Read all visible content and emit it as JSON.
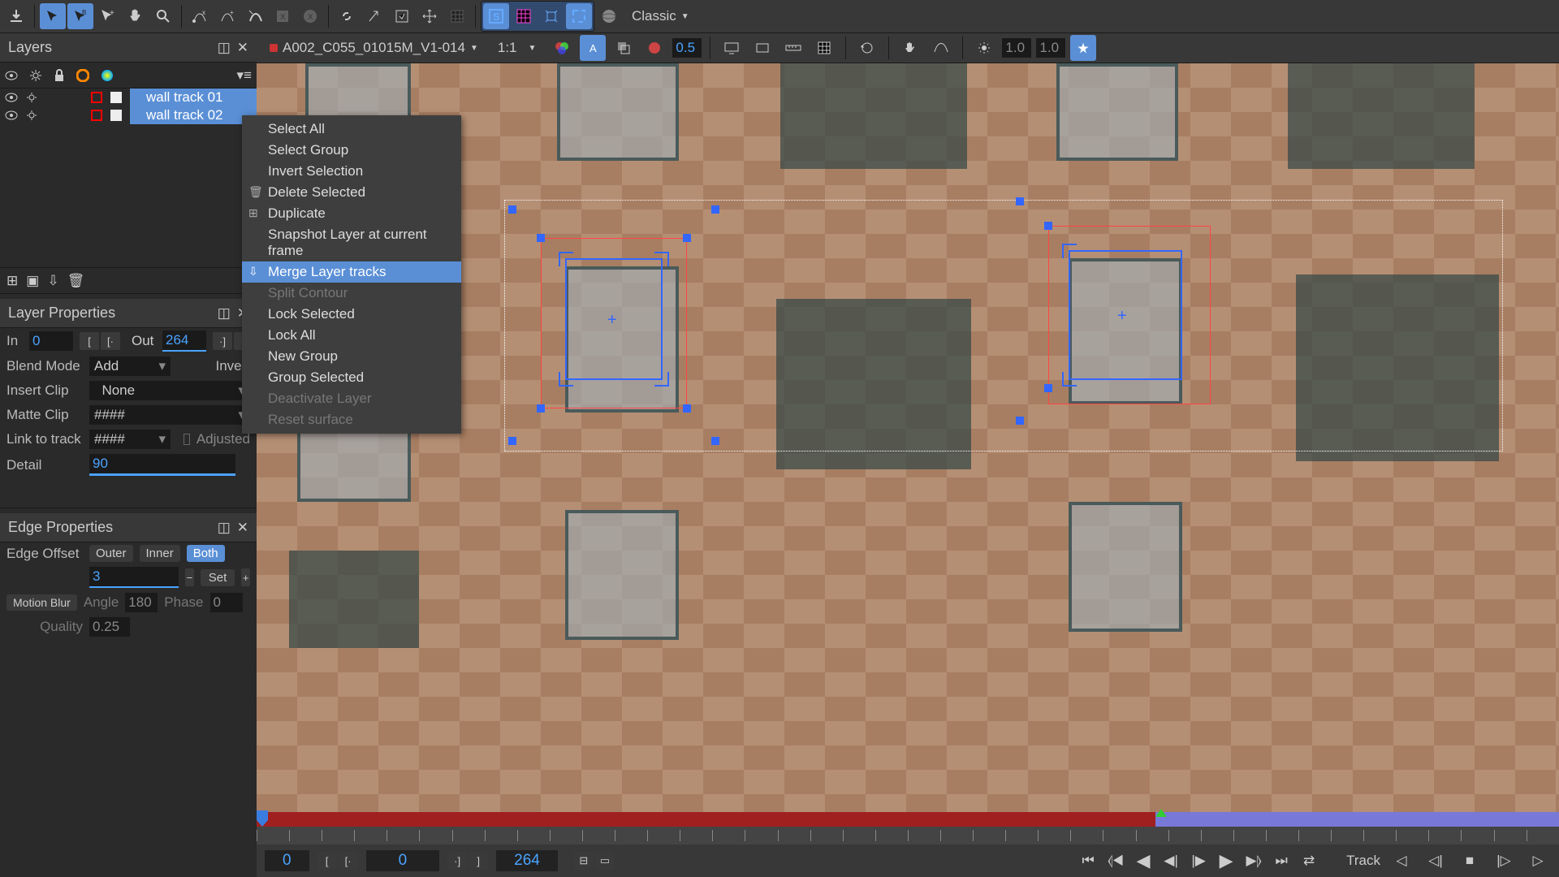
{
  "toolbar": {
    "layout_dropdown": "Classic"
  },
  "layers_panel": {
    "title": "Layers",
    "items": [
      {
        "name": "wall track 01"
      },
      {
        "name": "wall track 02"
      }
    ]
  },
  "context_menu": {
    "items": [
      {
        "label": "Select All",
        "icon": "",
        "disabled": false
      },
      {
        "label": "Select Group",
        "icon": "",
        "disabled": false
      },
      {
        "label": "Invert Selection",
        "icon": "",
        "disabled": false
      },
      {
        "label": "Delete Selected",
        "icon": "🗑",
        "disabled": false
      },
      {
        "label": "Duplicate",
        "icon": "⊞",
        "disabled": false
      },
      {
        "label": "Snapshot Layer at current frame",
        "icon": "",
        "disabled": false
      },
      {
        "label": "Merge Layer tracks",
        "icon": "⇩",
        "disabled": false,
        "highlight": true
      },
      {
        "label": "Split Contour",
        "icon": "",
        "disabled": true
      },
      {
        "label": "Lock Selected",
        "icon": "",
        "disabled": false
      },
      {
        "label": "Lock All",
        "icon": "",
        "disabled": false
      },
      {
        "label": "New Group",
        "icon": "",
        "disabled": false
      },
      {
        "label": "Group Selected",
        "icon": "",
        "disabled": false
      },
      {
        "label": "Deactivate Layer",
        "icon": "",
        "disabled": true
      },
      {
        "label": "Reset surface",
        "icon": "",
        "disabled": true
      }
    ]
  },
  "layer_props": {
    "title": "Layer Properties",
    "in_label": "In",
    "in_value": "0",
    "out_label": "Out",
    "out_value": "264",
    "blend_label": "Blend Mode",
    "blend_value": "Add",
    "invert_label": "Invert",
    "insert_label": "Insert Clip",
    "insert_value": "None",
    "matte_label": "Matte Clip",
    "matte_value": "####",
    "link_label": "Link to track",
    "link_value": "####",
    "adjusted_label": "Adjusted",
    "detail_label": "Detail",
    "detail_value": "90"
  },
  "edge_props": {
    "title": "Edge Properties",
    "offset_label": "Edge Offset",
    "outer": "Outer",
    "inner": "Inner",
    "both": "Both",
    "offset_value": "3",
    "set_label": "Set",
    "motion_blur": "Motion Blur",
    "angle_label": "Angle",
    "angle_value": "180",
    "phase_label": "Phase",
    "phase_value": "0",
    "quality_label": "Quality",
    "quality_value": "0.25"
  },
  "viewer_toolbar": {
    "clip_name": "A002_C055_01015M_V1-014",
    "zoom": "1:1",
    "opacity": "0.5",
    "exp1": "1.0",
    "exp2": "1.0"
  },
  "timeline": {
    "start_frame": "0",
    "current_frame": "0",
    "end_frame": "264",
    "track_label": "Track"
  }
}
